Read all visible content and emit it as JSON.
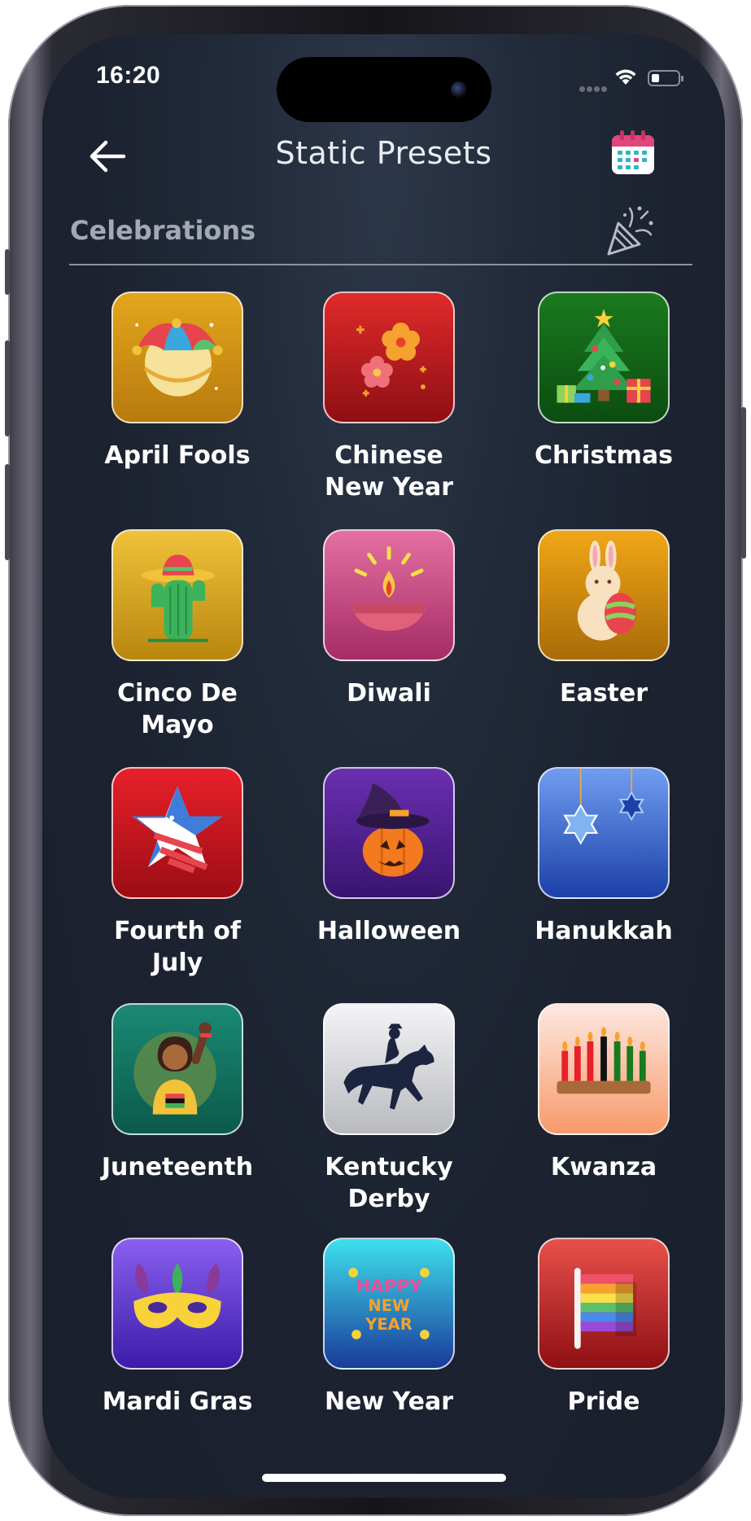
{
  "status_bar": {
    "time": "16:20"
  },
  "header": {
    "title": "Static Presets"
  },
  "section": {
    "label": "Celebrations"
  },
  "presets": [
    {
      "label": "April Fools"
    },
    {
      "label": "Chinese\nNew Year"
    },
    {
      "label": "Christmas"
    },
    {
      "label": "Cinco De\nMayo"
    },
    {
      "label": "Diwali"
    },
    {
      "label": "Easter"
    },
    {
      "label": "Fourth of\nJuly"
    },
    {
      "label": "Halloween"
    },
    {
      "label": "Hanukkah"
    },
    {
      "label": "Juneteenth"
    },
    {
      "label": "Kentucky\nDerby"
    },
    {
      "label": "Kwanza"
    },
    {
      "label": "Mardi Gras"
    },
    {
      "label": "New Year"
    },
    {
      "label": "Pride"
    }
  ],
  "new_year_icon_text": [
    "HAPPY",
    "NEW",
    "YEAR"
  ],
  "colors": {
    "background": "#1c2230",
    "text": "#ffffff",
    "section_label": "#a3a9b3"
  }
}
